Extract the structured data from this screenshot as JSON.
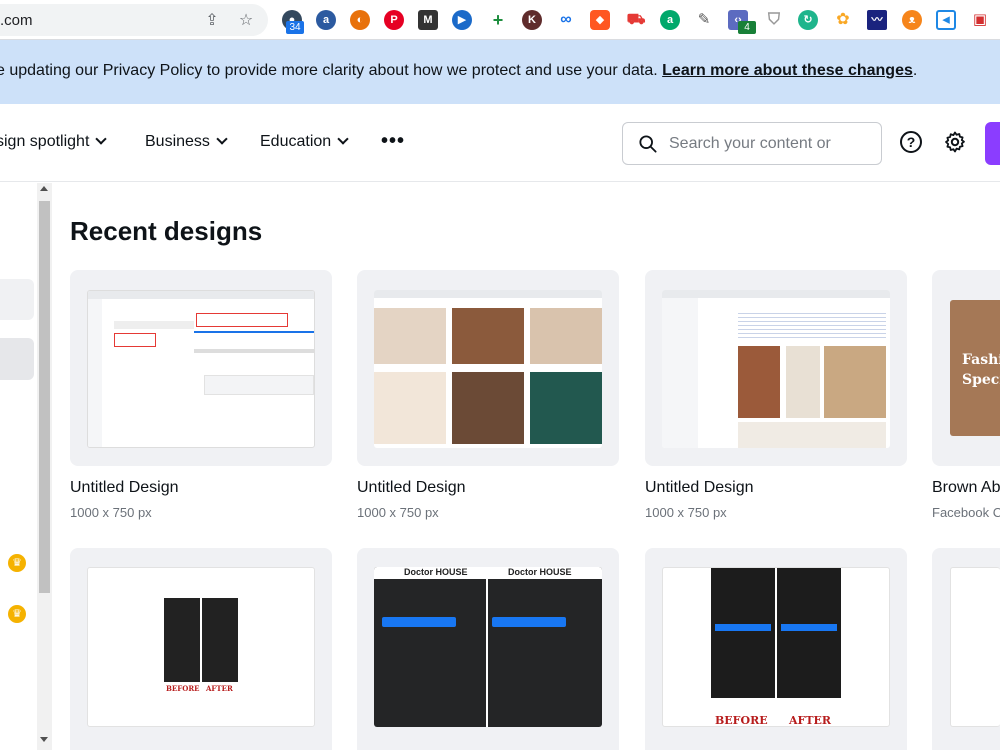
{
  "browser": {
    "url_fragment": ".com",
    "extension_badges": {
      "first": "34",
      "second": "4"
    }
  },
  "banner": {
    "text": "e updating our Privacy Policy to provide more clarity about how we protect and use your data. ",
    "link": "Learn more about these changes",
    "suffix": "."
  },
  "nav": {
    "items": [
      {
        "label": "sign spotlight"
      },
      {
        "label": "Business"
      },
      {
        "label": "Education"
      }
    ],
    "more": "•••",
    "search_placeholder": "Search your content or",
    "help": "?"
  },
  "main": {
    "heading": "Recent designs",
    "designs": [
      {
        "title": "Untitled Design",
        "size": "1000 x 750 px"
      },
      {
        "title": "Untitled Design",
        "size": "1000 x 750 px"
      },
      {
        "title": "Untitled Design",
        "size": "1000 x 750 px"
      },
      {
        "title": "Brown Ab",
        "size": "Facebook C",
        "thumb_text": "Fashi Speci"
      }
    ],
    "row2_labels": {
      "before": "BEFORE",
      "after": "AFTER",
      "doctor_house": "Doctor HOUSE"
    }
  },
  "colors": {
    "banner_bg": "#cde1f9",
    "accent_purple": "#8b3dff",
    "card_bg": "#f0f1f4",
    "crown": "#f5b200"
  }
}
